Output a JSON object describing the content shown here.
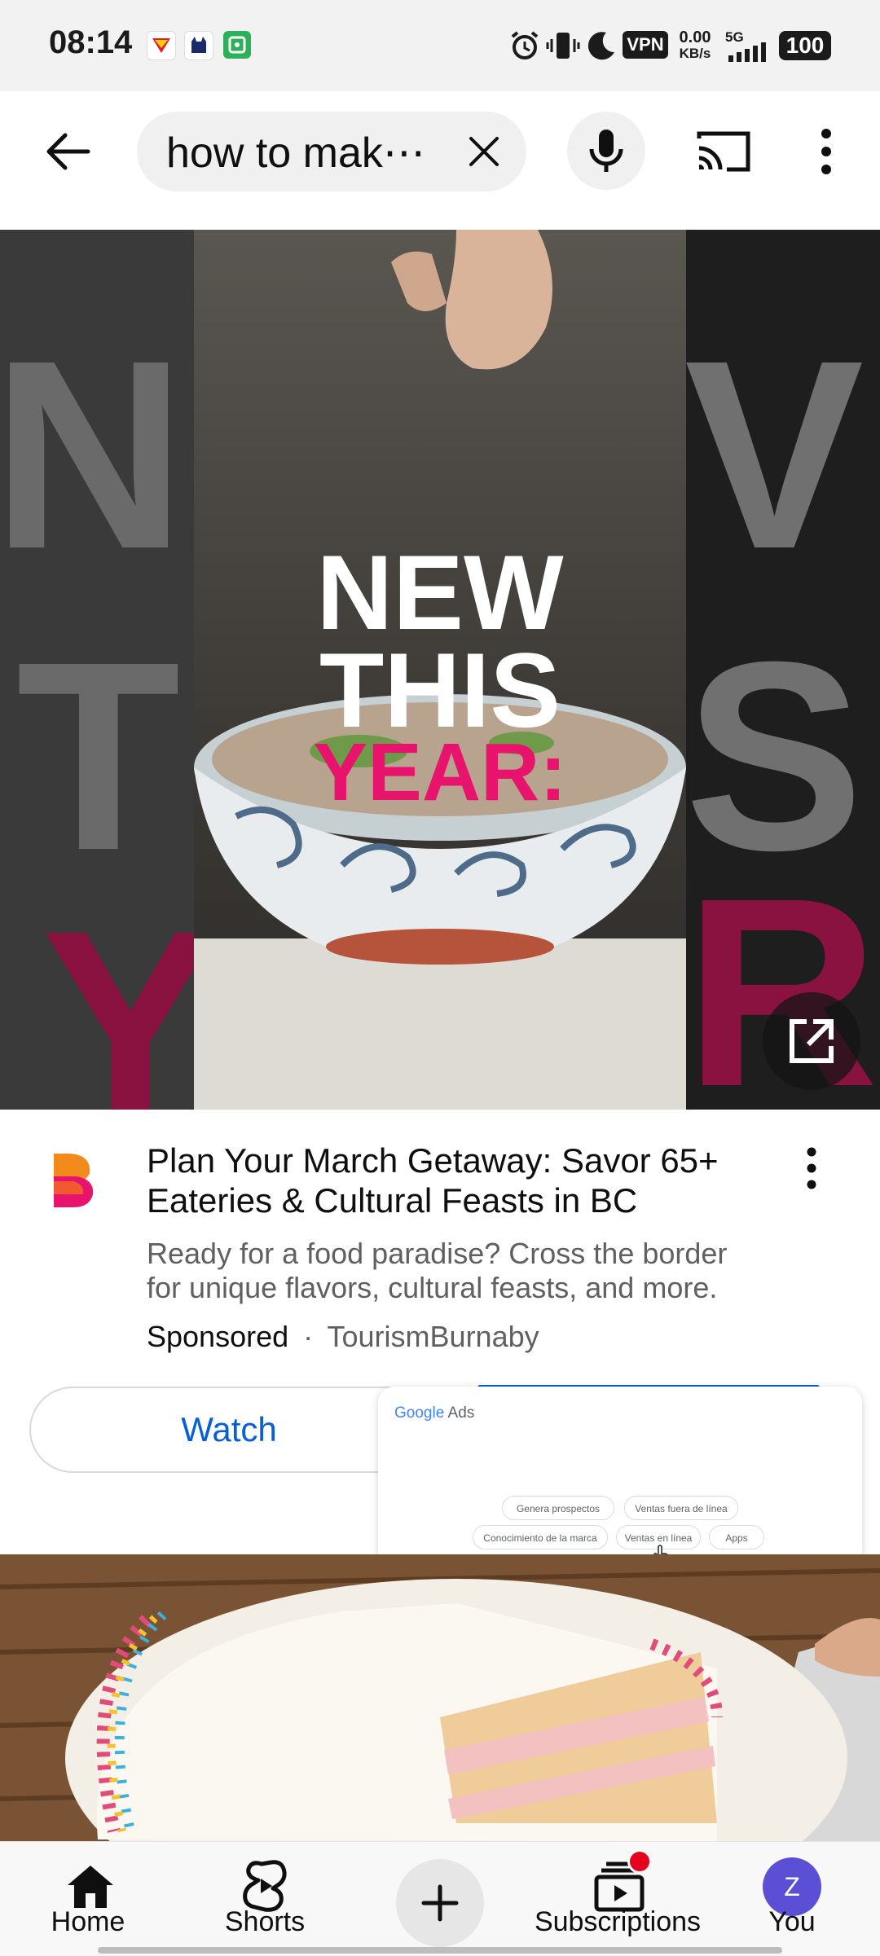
{
  "status_bar": {
    "time": "08:14",
    "vpn": "VPN",
    "speed_value": "0.00",
    "speed_unit": "KB/s",
    "network": "5G",
    "battery": "100"
  },
  "search": {
    "query": "how to mak⋯"
  },
  "ad": {
    "hero_text": [
      "NEW",
      "THIS",
      "YEAR:"
    ],
    "title": "Plan Your March Getaway: Savor 65+ Eateries & Cultural Feasts in BC",
    "description": "Ready for a food paradise? Cross the border for unique flavors, cultural feasts, and more.",
    "sponsored_label": "Sponsored",
    "separator": "·",
    "advertiser": "TourismBurnaby",
    "watch_label": "Watch"
  },
  "ads_popup": {
    "brand_google": "Google",
    "brand_ads": "Ads",
    "chips": [
      "Genera prospectos",
      "Ventas fuera de línea",
      "Conocimiento de la marca",
      "Ventas en línea",
      "Apps"
    ]
  },
  "nav": {
    "items": [
      {
        "label": "Home",
        "icon": "home-icon"
      },
      {
        "label": "Shorts",
        "icon": "shorts-icon"
      },
      {
        "label": "",
        "icon": "create-icon"
      },
      {
        "label": "Subscriptions",
        "icon": "subscriptions-icon"
      },
      {
        "label": "You",
        "icon": "avatar"
      }
    ],
    "avatar_letter": "Z"
  },
  "colors": {
    "accent_blue": "#065fd4",
    "hero_pink": "#e8136d",
    "avatar_purple": "#5b4fd6",
    "notification_red": "#e5001e"
  }
}
